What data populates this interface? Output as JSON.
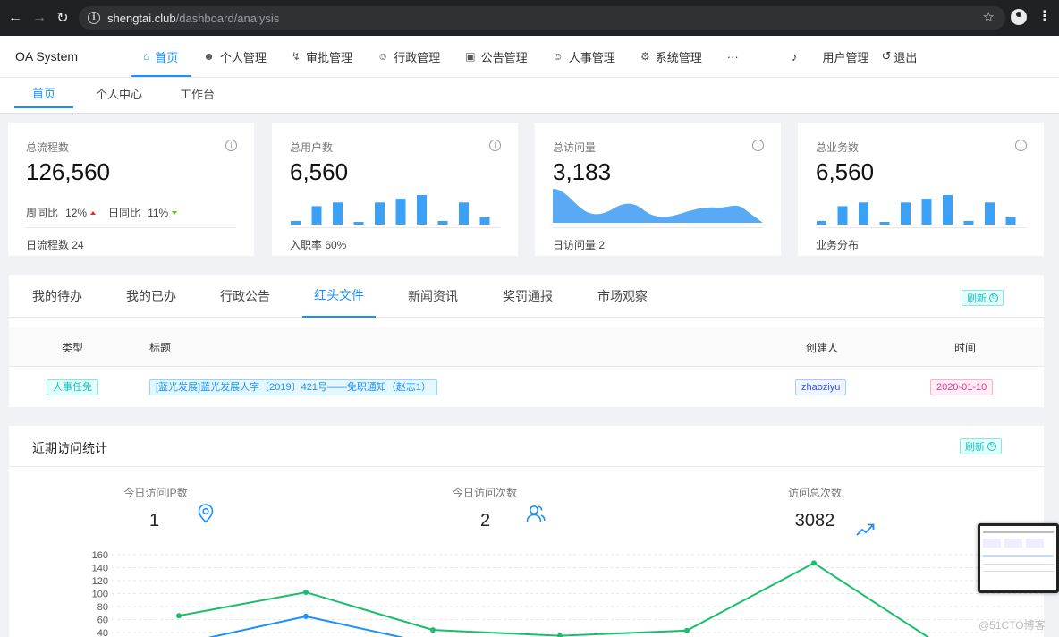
{
  "browser": {
    "host": "shengtai.club",
    "path": "/dashboard/analysis"
  },
  "app": {
    "logo": "OA System",
    "nav": [
      {
        "label": "首页",
        "icon": "home-icon"
      },
      {
        "label": "个人管理",
        "icon": "user-icon"
      },
      {
        "label": "审批管理",
        "icon": "bolt-icon"
      },
      {
        "label": "行政管理",
        "icon": "people-icon"
      },
      {
        "label": "公告管理",
        "icon": "video-icon"
      },
      {
        "label": "人事管理",
        "icon": "people-icon"
      },
      {
        "label": "系统管理",
        "icon": "gear-icon"
      },
      {
        "label": "···",
        "icon": ""
      }
    ],
    "user_menu": "用户管理",
    "logout": "退出"
  },
  "subtabs": [
    "首页",
    "个人中心",
    "工作台"
  ],
  "cards": {
    "process": {
      "title": "总流程数",
      "value": "126,560",
      "week_label": "周同比",
      "week_value": "12%",
      "day_label": "日同比",
      "day_value": "11%",
      "footer": "日流程数 24"
    },
    "users": {
      "title": "总用户数",
      "value": "6,560",
      "footer": "入职率 60%",
      "bars": [
        1,
        5,
        6,
        0,
        6,
        7,
        8,
        1,
        6,
        2
      ]
    },
    "visits": {
      "title": "总访问量",
      "value": "3,183",
      "footer": "日访问量 2"
    },
    "business": {
      "title": "总业务数",
      "value": "6,560",
      "footer": "业务分布",
      "bars": [
        1,
        5,
        6,
        0,
        6,
        7,
        8,
        1,
        6,
        2
      ]
    }
  },
  "panel": {
    "tabs": [
      "我的待办",
      "我的已办",
      "行政公告",
      "红头文件",
      "新闻资讯",
      "奖罚通报",
      "市场观察"
    ],
    "refresh": "刷新",
    "columns": [
      "类型",
      "标题",
      "创建人",
      "时间"
    ],
    "rows": [
      {
        "type": "人事任免",
        "title": "[蓝光发展]蓝光发展人字〔2019〕421号——免职通知（赵志1）",
        "creator": "zhaoziyu",
        "time": "2020-01-10"
      }
    ]
  },
  "visit": {
    "title": "近期访问统计",
    "refresh": "刷新",
    "stats": [
      {
        "label": "今日访问IP数",
        "value": "1",
        "icon": "location-icon"
      },
      {
        "label": "今日访问次数",
        "value": "2",
        "icon": "users-icon"
      },
      {
        "label": "访问总次数",
        "value": "3082",
        "icon": "trend-up-icon"
      }
    ]
  },
  "chart_data": {
    "type": "line",
    "y_ticks": [
      40,
      60,
      80,
      100,
      120,
      140,
      160
    ],
    "ylim": [
      40,
      160
    ],
    "series": [
      {
        "color": "#19be6b",
        "values": [
          66,
          102,
          44,
          35,
          43,
          147,
          20
        ]
      },
      {
        "color": "#1890ff",
        "values": [
          22,
          65,
          22,
          null,
          null,
          null,
          null
        ]
      }
    ]
  },
  "watermark": "@51CTO博客",
  "colors": {
    "primary": "#1890ff",
    "green": "#19be6b",
    "up": "#f5222d",
    "down": "#52c41a"
  }
}
